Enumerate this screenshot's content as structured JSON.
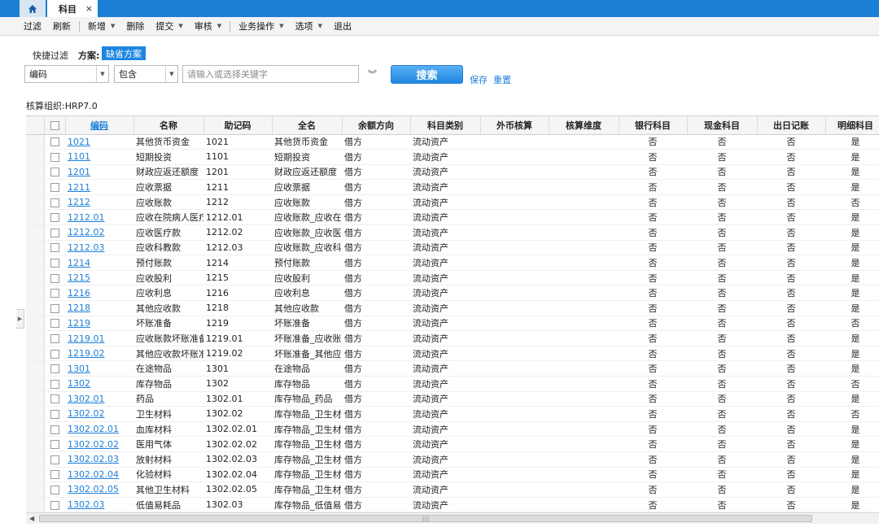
{
  "tabs": {
    "active_label": "科目",
    "close_glyph": "×",
    "home_icon": "home-icon"
  },
  "toolbar": {
    "filter": "过滤",
    "refresh": "刷新",
    "add": "新增",
    "delete": "删除",
    "submit": "提交",
    "audit": "审核",
    "business": "业务操作",
    "options": "选项",
    "exit": "退出"
  },
  "filter": {
    "quick_label": "快捷过滤",
    "plan_label": "方案:",
    "plan_value": "缺省方案",
    "field_value": "编码",
    "op_value": "包含",
    "keyword_placeholder": "请输入或选择关键字",
    "search_label": "搜索",
    "save_label": "保存",
    "reset_label": "重置"
  },
  "org": {
    "text": "核算组织:HRP7.0"
  },
  "colors": {
    "accent": "#1e86e0",
    "link": "#1e7fd8",
    "tabbar": "#1b7fd4"
  },
  "table": {
    "columns": [
      "编码",
      "名称",
      "助记码",
      "全名",
      "余额方向",
      "科目类别",
      "外币核算",
      "核算维度",
      "银行科目",
      "现金科目",
      "出日记账",
      "明细科目"
    ],
    "rows": [
      [
        "1021",
        "其他货币资金",
        "1021",
        "其他货币资金",
        "借方",
        "流动资产",
        "",
        "",
        "否",
        "否",
        "否",
        "是"
      ],
      [
        "1101",
        "短期投资",
        "1101",
        "短期投资",
        "借方",
        "流动资产",
        "",
        "",
        "否",
        "否",
        "否",
        "是"
      ],
      [
        "1201",
        "财政应返还额度",
        "1201",
        "财政应返还额度",
        "借方",
        "流动资产",
        "",
        "",
        "否",
        "否",
        "否",
        "是"
      ],
      [
        "1211",
        "应收票据",
        "1211",
        "应收票据",
        "借方",
        "流动资产",
        "",
        "",
        "否",
        "否",
        "否",
        "是"
      ],
      [
        "1212",
        "应收账款",
        "1212",
        "应收账款",
        "借方",
        "流动资产",
        "",
        "",
        "否",
        "否",
        "否",
        "否"
      ],
      [
        "1212.01",
        "应收在院病人医疗",
        "1212.01",
        "应收账款_应收在院",
        "借方",
        "流动资产",
        "",
        "",
        "否",
        "否",
        "否",
        "是"
      ],
      [
        "1212.02",
        "应收医疗款",
        "1212.02",
        "应收账款_应收医疗",
        "借方",
        "流动资产",
        "",
        "",
        "否",
        "否",
        "否",
        "是"
      ],
      [
        "1212.03",
        "应收科教款",
        "1212.03",
        "应收账款_应收科教",
        "借方",
        "流动资产",
        "",
        "",
        "否",
        "否",
        "否",
        "是"
      ],
      [
        "1214",
        "预付账款",
        "1214",
        "预付账款",
        "借方",
        "流动资产",
        "",
        "",
        "否",
        "否",
        "否",
        "是"
      ],
      [
        "1215",
        "应收股利",
        "1215",
        "应收股利",
        "借方",
        "流动资产",
        "",
        "",
        "否",
        "否",
        "否",
        "是"
      ],
      [
        "1216",
        "应收利息",
        "1216",
        "应收利息",
        "借方",
        "流动资产",
        "",
        "",
        "否",
        "否",
        "否",
        "是"
      ],
      [
        "1218",
        "其他应收款",
        "1218",
        "其他应收款",
        "借方",
        "流动资产",
        "",
        "",
        "否",
        "否",
        "否",
        "是"
      ],
      [
        "1219",
        "坏账准备",
        "1219",
        "坏账准备",
        "借方",
        "流动资产",
        "",
        "",
        "否",
        "否",
        "否",
        "否"
      ],
      [
        "1219.01",
        "应收账款坏账准备",
        "1219.01",
        "坏账准备_应收账款",
        "借方",
        "流动资产",
        "",
        "",
        "否",
        "否",
        "否",
        "是"
      ],
      [
        "1219.02",
        "其他应收款坏账准备",
        "1219.02",
        "坏账准备_其他应收",
        "借方",
        "流动资产",
        "",
        "",
        "否",
        "否",
        "否",
        "是"
      ],
      [
        "1301",
        "在途物品",
        "1301",
        "在途物品",
        "借方",
        "流动资产",
        "",
        "",
        "否",
        "否",
        "否",
        "是"
      ],
      [
        "1302",
        "库存物品",
        "1302",
        "库存物品",
        "借方",
        "流动资产",
        "",
        "",
        "否",
        "否",
        "否",
        "否"
      ],
      [
        "1302.01",
        "药品",
        "1302.01",
        "库存物品_药品",
        "借方",
        "流动资产",
        "",
        "",
        "否",
        "否",
        "否",
        "是"
      ],
      [
        "1302.02",
        "卫生材料",
        "1302.02",
        "库存物品_卫生材料",
        "借方",
        "流动资产",
        "",
        "",
        "否",
        "否",
        "否",
        "否"
      ],
      [
        "1302.02.01",
        "血库材料",
        "1302.02.01",
        "库存物品_卫生材料",
        "借方",
        "流动资产",
        "",
        "",
        "否",
        "否",
        "否",
        "是"
      ],
      [
        "1302.02.02",
        "医用气体",
        "1302.02.02",
        "库存物品_卫生材料",
        "借方",
        "流动资产",
        "",
        "",
        "否",
        "否",
        "否",
        "是"
      ],
      [
        "1302.02.03",
        "放射材料",
        "1302.02.03",
        "库存物品_卫生材料",
        "借方",
        "流动资产",
        "",
        "",
        "否",
        "否",
        "否",
        "是"
      ],
      [
        "1302.02.04",
        "化验材料",
        "1302.02.04",
        "库存物品_卫生材料",
        "借方",
        "流动资产",
        "",
        "",
        "否",
        "否",
        "否",
        "是"
      ],
      [
        "1302.02.05",
        "其他卫生材料",
        "1302.02.05",
        "库存物品_卫生材料",
        "借方",
        "流动资产",
        "",
        "",
        "否",
        "否",
        "否",
        "是"
      ],
      [
        "1302.03",
        "低值易耗品",
        "1302.03",
        "库存物品_低值易耗",
        "借方",
        "流动资产",
        "",
        "",
        "否",
        "否",
        "否",
        "是"
      ]
    ]
  }
}
